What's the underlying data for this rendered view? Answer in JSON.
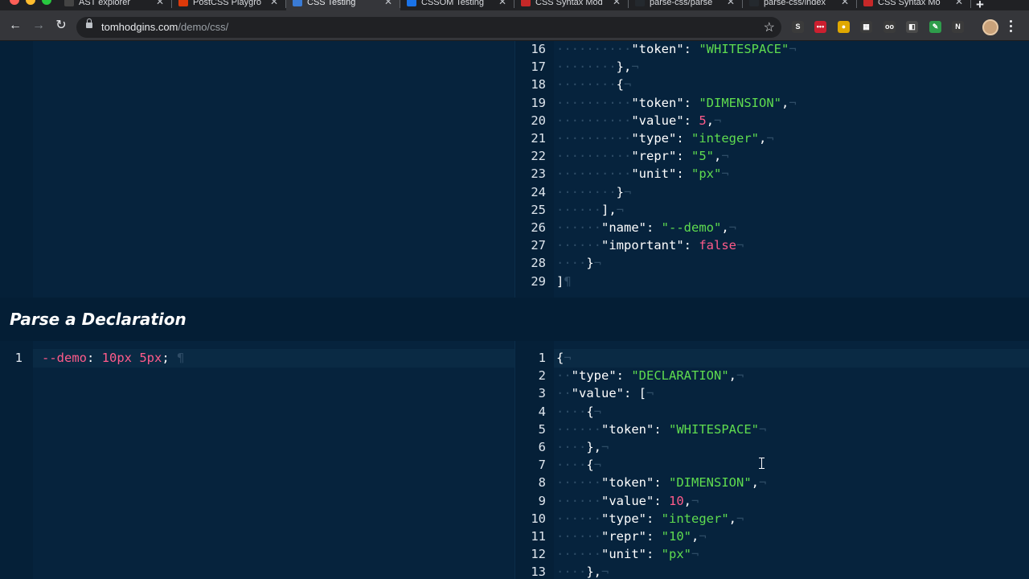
{
  "browser": {
    "tabs": [
      {
        "label": "AST explorer",
        "icon": "ast-favicon",
        "active": false
      },
      {
        "label": "PostCSS Playgro",
        "icon": "postcss-favicon",
        "active": false
      },
      {
        "label": "CSS Testing",
        "icon": "css-favicon",
        "active": true
      },
      {
        "label": "CSSOM Testing",
        "icon": "globe-favicon",
        "active": false
      },
      {
        "label": "CSS Syntax Mod",
        "icon": "w3c-css-favicon",
        "active": false
      },
      {
        "label": "parse-css/parse",
        "icon": "github-favicon",
        "active": false
      },
      {
        "label": "parse-css/index",
        "icon": "github-favicon",
        "active": false
      },
      {
        "label": "CSS Syntax Mo",
        "icon": "w3c-css-favicon",
        "active": false
      }
    ],
    "new_tab_label": "+",
    "close_glyph": "✕",
    "url_host": "tomhodgins.com",
    "url_path": "/demo/css/",
    "star_glyph": "☆",
    "back_glyph": "←",
    "forward_glyph": "→",
    "reload_glyph": "↻",
    "extensions": [
      {
        "name": "s-extension-icon",
        "glyph": "S",
        "color": "#3b3b3b"
      },
      {
        "name": "lastpass-icon",
        "glyph": "•••",
        "color": "#cc1f2f"
      },
      {
        "name": "chrome-color-icon",
        "glyph": "●",
        "color": "#e0a800"
      },
      {
        "name": "calendar-extension-icon",
        "glyph": "▦",
        "color": "#3b3b3b"
      },
      {
        "name": "glasses-extension-icon",
        "glyph": "oo",
        "color": "#3b3b3b"
      },
      {
        "name": "puzzle-extension-icon",
        "glyph": "◧",
        "color": "#4a4a4a"
      },
      {
        "name": "color-picker-icon",
        "glyph": "✎",
        "color": "#2e9d4b"
      },
      {
        "name": "n-extension-icon",
        "glyph": "N",
        "color": "#3b3b3b"
      }
    ]
  },
  "top_output": {
    "lines": [
      {
        "n": "16",
        "tokens": [
          [
            "ws",
            "····"
          ],
          [
            "ws",
            "··"
          ],
          [
            "ws",
            "··"
          ],
          [
            "ws",
            "··"
          ],
          [
            "key",
            "\"token\""
          ],
          [
            "pn",
            ": "
          ],
          [
            "str",
            "\"WHITESPACE\""
          ],
          [
            "ws",
            "¬"
          ]
        ]
      },
      {
        "n": "17",
        "tokens": [
          [
            "ws",
            "····"
          ],
          [
            "ws",
            "··"
          ],
          [
            "ws",
            "··"
          ],
          [
            "pn",
            "},"
          ],
          [
            "ws",
            "¬"
          ]
        ]
      },
      {
        "n": "18",
        "tokens": [
          [
            "ws",
            "····"
          ],
          [
            "ws",
            "··"
          ],
          [
            "ws",
            "··"
          ],
          [
            "pn",
            "{"
          ],
          [
            "ws",
            "¬"
          ]
        ]
      },
      {
        "n": "19",
        "tokens": [
          [
            "ws",
            "····"
          ],
          [
            "ws",
            "··"
          ],
          [
            "ws",
            "··"
          ],
          [
            "ws",
            "··"
          ],
          [
            "key",
            "\"token\""
          ],
          [
            "pn",
            ": "
          ],
          [
            "str",
            "\"DIMENSION\""
          ],
          [
            "pn",
            ","
          ],
          [
            "ws",
            "¬"
          ]
        ]
      },
      {
        "n": "20",
        "tokens": [
          [
            "ws",
            "····"
          ],
          [
            "ws",
            "··"
          ],
          [
            "ws",
            "··"
          ],
          [
            "ws",
            "··"
          ],
          [
            "key",
            "\"value\""
          ],
          [
            "pn",
            ": "
          ],
          [
            "num",
            "5"
          ],
          [
            "pn",
            ","
          ],
          [
            "ws",
            "¬"
          ]
        ]
      },
      {
        "n": "21",
        "tokens": [
          [
            "ws",
            "····"
          ],
          [
            "ws",
            "··"
          ],
          [
            "ws",
            "··"
          ],
          [
            "ws",
            "··"
          ],
          [
            "key",
            "\"type\""
          ],
          [
            "pn",
            ": "
          ],
          [
            "str",
            "\"integer\""
          ],
          [
            "pn",
            ","
          ],
          [
            "ws",
            "¬"
          ]
        ]
      },
      {
        "n": "22",
        "tokens": [
          [
            "ws",
            "····"
          ],
          [
            "ws",
            "··"
          ],
          [
            "ws",
            "··"
          ],
          [
            "ws",
            "··"
          ],
          [
            "key",
            "\"repr\""
          ],
          [
            "pn",
            ": "
          ],
          [
            "str",
            "\"5\""
          ],
          [
            "pn",
            ","
          ],
          [
            "ws",
            "¬"
          ]
        ]
      },
      {
        "n": "23",
        "tokens": [
          [
            "ws",
            "····"
          ],
          [
            "ws",
            "··"
          ],
          [
            "ws",
            "··"
          ],
          [
            "ws",
            "··"
          ],
          [
            "key",
            "\"unit\""
          ],
          [
            "pn",
            ": "
          ],
          [
            "str",
            "\"px\""
          ],
          [
            "ws",
            "¬"
          ]
        ]
      },
      {
        "n": "24",
        "tokens": [
          [
            "ws",
            "····"
          ],
          [
            "ws",
            "··"
          ],
          [
            "ws",
            "··"
          ],
          [
            "pn",
            "}"
          ],
          [
            "ws",
            "¬"
          ]
        ]
      },
      {
        "n": "25",
        "tokens": [
          [
            "ws",
            "····"
          ],
          [
            "ws",
            "··"
          ],
          [
            "pn",
            "],"
          ],
          [
            "ws",
            "¬"
          ]
        ]
      },
      {
        "n": "26",
        "tokens": [
          [
            "ws",
            "····"
          ],
          [
            "ws",
            "··"
          ],
          [
            "key",
            "\"name\""
          ],
          [
            "pn",
            ": "
          ],
          [
            "str",
            "\"--demo\""
          ],
          [
            "pn",
            ","
          ],
          [
            "ws",
            "¬"
          ]
        ]
      },
      {
        "n": "27",
        "tokens": [
          [
            "ws",
            "····"
          ],
          [
            "ws",
            "··"
          ],
          [
            "key",
            "\"important\""
          ],
          [
            "pn",
            ": "
          ],
          [
            "kw",
            "false"
          ],
          [
            "ws",
            "¬"
          ]
        ]
      },
      {
        "n": "28",
        "tokens": [
          [
            "ws",
            "····"
          ],
          [
            "pn",
            "}"
          ],
          [
            "ws",
            "¬"
          ]
        ]
      },
      {
        "n": "29",
        "tokens": [
          [
            "pn",
            "]"
          ],
          [
            "ws",
            "¶"
          ]
        ]
      }
    ]
  },
  "section": {
    "title": "Parse a Declaration"
  },
  "input_editor": {
    "lines": [
      {
        "n": "1",
        "tokens": [
          [
            "prop",
            "--demo"
          ],
          [
            "pn",
            ": "
          ],
          [
            "num",
            "10px"
          ],
          [
            "pn",
            " "
          ],
          [
            "num",
            "5px"
          ],
          [
            "pn",
            ";"
          ],
          [
            "ws",
            " ¶"
          ]
        ]
      }
    ]
  },
  "bottom_output": {
    "lines": [
      {
        "n": "1",
        "tokens": [
          [
            "pn",
            "{"
          ],
          [
            "ws",
            "¬"
          ]
        ]
      },
      {
        "n": "2",
        "tokens": [
          [
            "ws",
            "··"
          ],
          [
            "key",
            "\"type\""
          ],
          [
            "pn",
            ": "
          ],
          [
            "str",
            "\"DECLARATION\""
          ],
          [
            "pn",
            ","
          ],
          [
            "ws",
            "¬"
          ]
        ]
      },
      {
        "n": "3",
        "tokens": [
          [
            "ws",
            "··"
          ],
          [
            "key",
            "\"value\""
          ],
          [
            "pn",
            ": ["
          ],
          [
            "ws",
            "¬"
          ]
        ]
      },
      {
        "n": "4",
        "tokens": [
          [
            "ws",
            "····"
          ],
          [
            "pn",
            "{"
          ],
          [
            "ws",
            "¬"
          ]
        ]
      },
      {
        "n": "5",
        "tokens": [
          [
            "ws",
            "····"
          ],
          [
            "ws",
            "··"
          ],
          [
            "key",
            "\"token\""
          ],
          [
            "pn",
            ": "
          ],
          [
            "str",
            "\"WHITESPACE\""
          ],
          [
            "ws",
            "¬"
          ]
        ]
      },
      {
        "n": "6",
        "tokens": [
          [
            "ws",
            "····"
          ],
          [
            "pn",
            "},"
          ],
          [
            "ws",
            "¬"
          ]
        ]
      },
      {
        "n": "7",
        "tokens": [
          [
            "ws",
            "····"
          ],
          [
            "pn",
            "{"
          ],
          [
            "ws",
            "¬"
          ]
        ]
      },
      {
        "n": "8",
        "tokens": [
          [
            "ws",
            "····"
          ],
          [
            "ws",
            "··"
          ],
          [
            "key",
            "\"token\""
          ],
          [
            "pn",
            ": "
          ],
          [
            "str",
            "\"DIMENSION\""
          ],
          [
            "pn",
            ","
          ],
          [
            "ws",
            "¬"
          ]
        ]
      },
      {
        "n": "9",
        "tokens": [
          [
            "ws",
            "····"
          ],
          [
            "ws",
            "··"
          ],
          [
            "key",
            "\"value\""
          ],
          [
            "pn",
            ": "
          ],
          [
            "num",
            "10"
          ],
          [
            "pn",
            ","
          ],
          [
            "ws",
            "¬"
          ]
        ]
      },
      {
        "n": "10",
        "tokens": [
          [
            "ws",
            "····"
          ],
          [
            "ws",
            "··"
          ],
          [
            "key",
            "\"type\""
          ],
          [
            "pn",
            ": "
          ],
          [
            "str",
            "\"integer\""
          ],
          [
            "pn",
            ","
          ],
          [
            "ws",
            "¬"
          ]
        ]
      },
      {
        "n": "11",
        "tokens": [
          [
            "ws",
            "····"
          ],
          [
            "ws",
            "··"
          ],
          [
            "key",
            "\"repr\""
          ],
          [
            "pn",
            ": "
          ],
          [
            "str",
            "\"10\""
          ],
          [
            "pn",
            ","
          ],
          [
            "ws",
            "¬"
          ]
        ]
      },
      {
        "n": "12",
        "tokens": [
          [
            "ws",
            "····"
          ],
          [
            "ws",
            "··"
          ],
          [
            "key",
            "\"unit\""
          ],
          [
            "pn",
            ": "
          ],
          [
            "str",
            "\"px\""
          ],
          [
            "ws",
            "¬"
          ]
        ]
      },
      {
        "n": "13",
        "tokens": [
          [
            "ws",
            "····"
          ],
          [
            "pn",
            "},"
          ],
          [
            "ws",
            "¬"
          ]
        ]
      }
    ]
  },
  "colors": {
    "background": "#06233d",
    "string": "#5fdc4f",
    "number": "#ff5b8a",
    "keyword": "#ff5b8a",
    "whitespace_marker": "#2e4c66"
  }
}
